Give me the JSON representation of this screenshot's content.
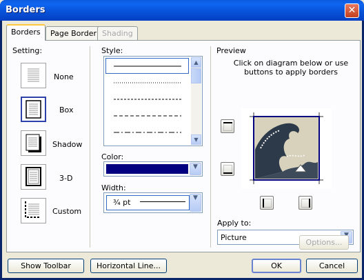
{
  "window": {
    "title": "Borders",
    "close_label": "✕"
  },
  "tabs": [
    {
      "label": "Borders"
    },
    {
      "label": "Page Border"
    },
    {
      "label": "Shading"
    }
  ],
  "setting": {
    "header": "Setting:",
    "items": [
      {
        "label": "None"
      },
      {
        "label": "Box"
      },
      {
        "label": "Shadow"
      },
      {
        "label": "3-D"
      },
      {
        "label": "Custom"
      }
    ],
    "selected": "Box"
  },
  "style": {
    "label": "Style:"
  },
  "color": {
    "label": "Color:",
    "value": "#000080"
  },
  "width": {
    "label": "Width:",
    "value": "¾ pt"
  },
  "preview": {
    "label": "Preview",
    "instructions_1": "Click on diagram below or use",
    "instructions_2": "buttons to apply borders"
  },
  "apply_to": {
    "label": "Apply to:",
    "value": "Picture"
  },
  "options_label": "Options...",
  "footer": {
    "show_toolbar": "Show Toolbar",
    "horizontal_line": "Horizontal Line...",
    "ok": "OK",
    "cancel": "Cancel"
  }
}
